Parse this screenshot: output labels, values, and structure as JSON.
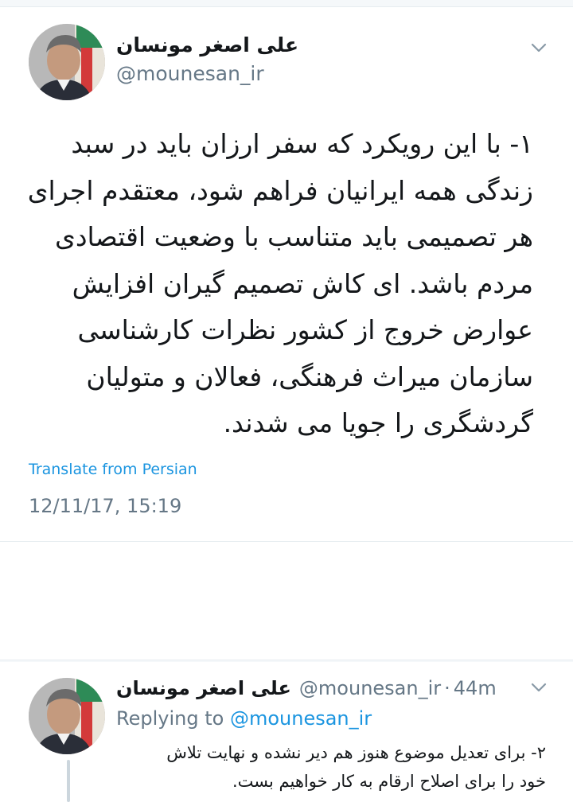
{
  "tweet": {
    "author_name": "علی اصغر مونسان",
    "author_handle": "@mounesan_ir",
    "text_lines": [
      "۱- با این رویکرد که سفر ارزان باید در سبد",
      "زندگی همه ایرانیان فراهم شود، معتقدم اجرای",
      "هر تصمیمی باید متناسب با وضعیت اقتصادی",
      "مردم باشد. ای کاش تصمیم گیران افزایش",
      "عوارض خروج از کشور نظرات کارشناسی",
      "سازمان میراث فرهنگی، فعالان و متولیان",
      "گردشگری را جویا می شدند."
    ],
    "translate_label": "Translate from Persian",
    "timestamp": "12/11/17, 15:19",
    "menu_icon": "chevron-down-icon"
  },
  "reply": {
    "author_name": "علی اصغر مونسان",
    "author_handle": "@mounesan_ir",
    "separator": "·",
    "time_ago": "44m",
    "replying_prefix": "Replying to",
    "replying_to": "@mounesan_ir",
    "text_lines": [
      "۲- برای تعدیل موضوع هنوز هم دیر نشده و نهایت تلاش",
      "خود را برای اصلاح ارقام به کار خواهیم بست."
    ],
    "menu_icon": "chevron-down-icon"
  },
  "colors": {
    "link": "#1b95e0",
    "secondary_text": "#657786",
    "primary_text": "#14171a",
    "divider": "#e6ecf0"
  }
}
